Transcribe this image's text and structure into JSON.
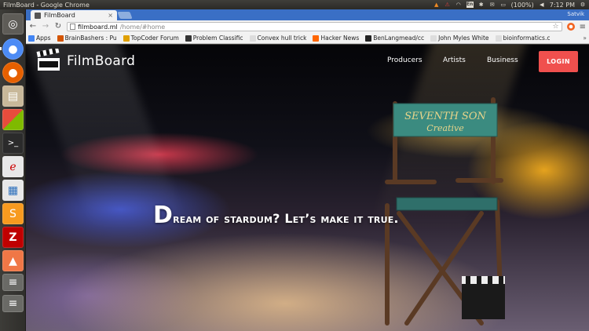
{
  "os": {
    "window_title": "FilmBoard - Google Chrome",
    "battery": "(100%)",
    "clock": "7:12 PM",
    "keyboard_layout": "En",
    "tray_icons": [
      "vlc-icon",
      "warning-icon",
      "wifi-icon",
      "keyboard-icon",
      "bluetooth-icon",
      "mail-icon",
      "battery-icon",
      "volume-icon",
      "settings-icon"
    ]
  },
  "launcher": {
    "items": [
      {
        "name": "ubuntu-dash",
        "color": "#5e5c57"
      },
      {
        "name": "chrome",
        "color": "#4c8bf5"
      },
      {
        "name": "firefox",
        "color": "#e66000"
      },
      {
        "name": "files",
        "color": "#c8b89a"
      },
      {
        "name": "software-center",
        "color": "#7fba00"
      },
      {
        "name": "terminal",
        "color": "#2b2b2b"
      },
      {
        "name": "app-red-e",
        "color": "#e8e8e8"
      },
      {
        "name": "libreoffice-writer",
        "color": "#e8e8e8"
      },
      {
        "name": "sublime-text",
        "color": "#f79a1f"
      },
      {
        "name": "filezilla",
        "color": "#bf0000"
      },
      {
        "name": "software-updater",
        "color": "#f07746"
      }
    ]
  },
  "browser": {
    "tab": {
      "title": "FilmBoard",
      "close_glyph": "×"
    },
    "profile": "Satvik",
    "url_host": "filmboard.ml",
    "url_path": "/home/#home",
    "bookmarks": [
      {
        "label": "Apps",
        "icon_color": "#4285f4"
      },
      {
        "label": "BrainBashers : Pu",
        "icon_color": "#d35400"
      },
      {
        "label": "TopCoder Forum",
        "icon_color": "#e0a000"
      },
      {
        "label": "Problem Classific",
        "icon_color": "#333333"
      },
      {
        "label": "Convex hull trick",
        "icon_color": "#dddddd"
      },
      {
        "label": "Hacker News",
        "icon_color": "#ff6600"
      },
      {
        "label": "BenLangmead/cc",
        "icon_color": "#222222"
      },
      {
        "label": "John Myles White",
        "icon_color": "#dddddd"
      },
      {
        "label": "bioinformatics.c",
        "icon_color": "#dddddd"
      }
    ],
    "bookmarks_more": "»"
  },
  "page": {
    "brand_name": "FilmBoard",
    "nav": {
      "producers": "Producers",
      "artists": "Artists",
      "business": "Business"
    },
    "login": "LOGIN",
    "headline": "Dream of stardum? Let’s make it true.",
    "chair_sign": {
      "line1": "SEVENTH SON",
      "line2": "Creative"
    },
    "accent_color": "#f0504e"
  }
}
